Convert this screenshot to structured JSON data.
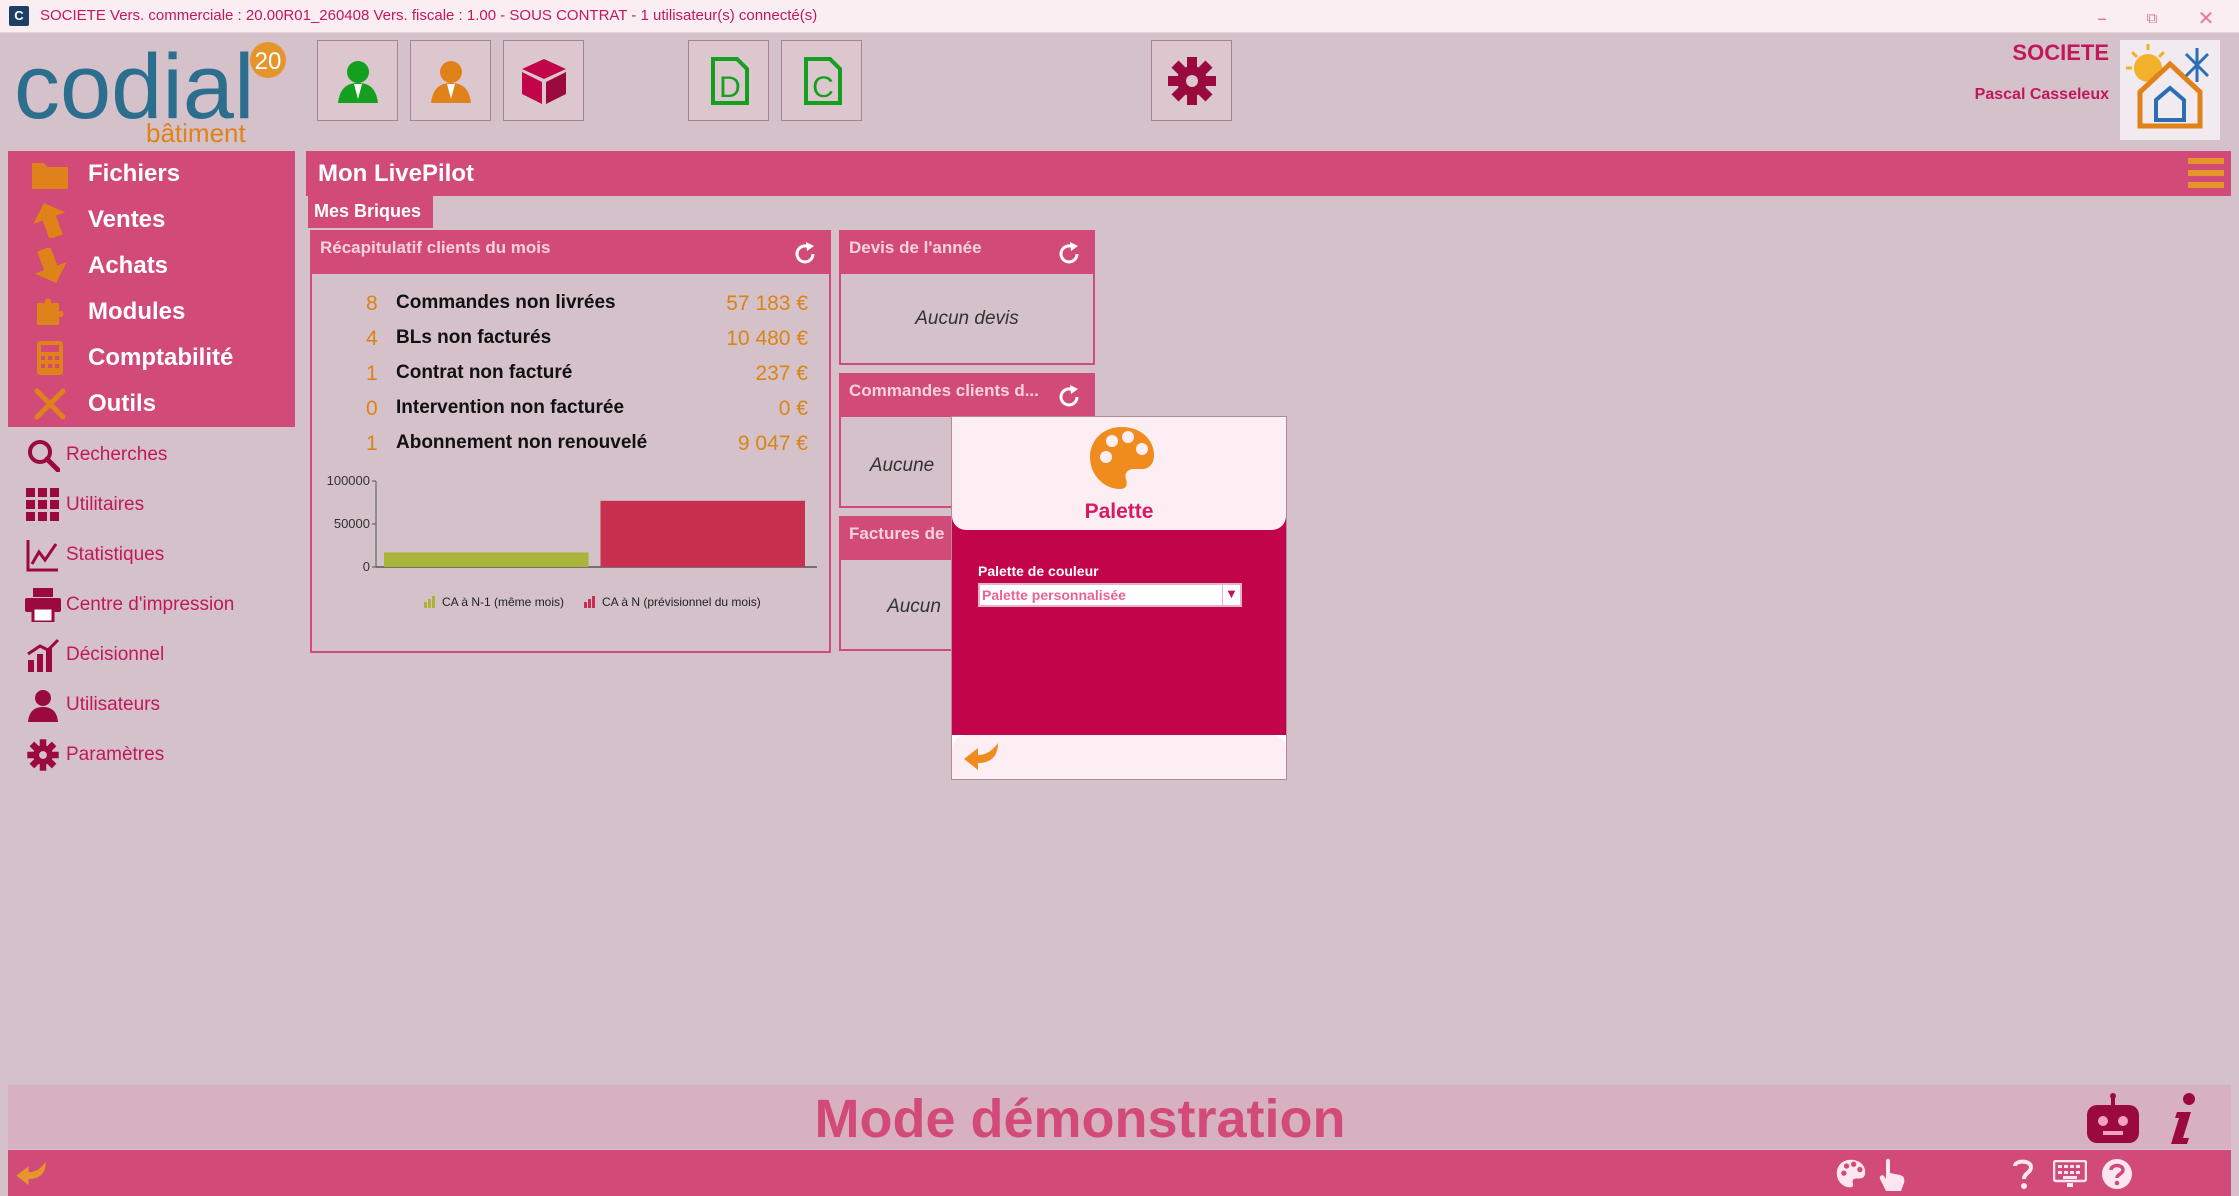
{
  "window": {
    "app_icon": "C",
    "title": "SOCIETE Vers. commerciale : 20.00R01_260408 Vers. fiscale : 1.00 - SOUS CONTRAT - 1 utilisateur(s) connecté(s)",
    "minimize_glyph": "–",
    "restore_glyph": "⧉",
    "close_glyph": "✕"
  },
  "logo": {
    "text": "codial",
    "sub": "bâtiment",
    "badge": "20"
  },
  "header": {
    "company": "SOCIETE",
    "user": "Pascal Casseleux",
    "toolbar_icons": [
      "client-icon",
      "representative-icon",
      "article-box-icon",
      "document-d-icon",
      "document-c-icon",
      "settings-gear-icon"
    ]
  },
  "sidebar": {
    "main": [
      {
        "label": "Fichiers",
        "icon": "folder-icon"
      },
      {
        "label": "Ventes",
        "icon": "sales-arrow-icon"
      },
      {
        "label": "Achats",
        "icon": "purchases-arrow-icon"
      },
      {
        "label": "Modules",
        "icon": "puzzle-icon"
      },
      {
        "label": "Comptabilité",
        "icon": "calculator-icon"
      },
      {
        "label": "Outils",
        "icon": "tools-icon"
      }
    ],
    "links": [
      {
        "label": "Recherches",
        "icon": "search-icon"
      },
      {
        "label": "Utilitaires",
        "icon": "grid-icon"
      },
      {
        "label": "Statistiques",
        "icon": "chart-icon"
      },
      {
        "label": "Centre d'impression",
        "icon": "printer-icon"
      },
      {
        "label": "Décisionnel",
        "icon": "decision-chart-icon"
      },
      {
        "label": "Utilisateurs",
        "icon": "user-icon"
      },
      {
        "label": "Paramètres",
        "icon": "gear-icon"
      }
    ]
  },
  "main": {
    "title": "Mon LivePilot",
    "tab": "Mes Briques",
    "recap": {
      "title": "Récapitulatif clients du mois",
      "rows": [
        {
          "count": "8",
          "label": "Commandes non livrées",
          "amount": "57 183 €"
        },
        {
          "count": "4",
          "label": "BLs non facturés",
          "amount": "10 480 €"
        },
        {
          "count": "1",
          "label": "Contrat non facturé",
          "amount": "237 €"
        },
        {
          "count": "0",
          "label": "Intervention non facturée",
          "amount": "0 €"
        },
        {
          "count": "1",
          "label": "Abonnement non renouvelé",
          "amount": "9 047 €"
        }
      ]
    },
    "devis": {
      "title": "Devis de l'année",
      "empty": "Aucun devis"
    },
    "commandes": {
      "title": "Commandes clients d...",
      "empty": "Aucune"
    },
    "factures": {
      "title": "Factures de",
      "empty": "Aucun"
    }
  },
  "chart_data": {
    "type": "bar",
    "title": "",
    "categories": [
      "CA à N-1 (même mois)",
      "CA à N (prévisionnel du mois)"
    ],
    "series": [
      {
        "name": "CA à N-1 (même mois)",
        "values": [
          17000
        ],
        "color": "#a9b53a"
      },
      {
        "name": "CA à N (prévisionnel du mois)",
        "values": [
          77000
        ],
        "color": "#c9304f"
      }
    ],
    "yticks": [
      "100000",
      "50000",
      "0"
    ],
    "ylim": [
      0,
      100000
    ],
    "legend": "bottom"
  },
  "modal": {
    "title": "Palette",
    "field_label": "Palette de couleur",
    "selected": "Palette personnalisée"
  },
  "footer": {
    "demo_text": "Mode démonstration"
  },
  "colors": {
    "accent": "#d14a78",
    "accent_dark": "#c2054b",
    "orange": "#d98516",
    "background": "#d4c1c9"
  }
}
